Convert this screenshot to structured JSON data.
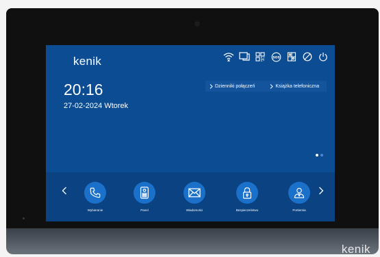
{
  "brand": "kenik",
  "clock": {
    "time": "20:16",
    "date": "27-02-2024 Wtorek"
  },
  "quick_links": [
    {
      "label": "Dzienniki połączeń"
    },
    {
      "label": "Książka telefoniczna"
    }
  ],
  "status_icons": [
    "wifi-off-icon",
    "monitor-icon",
    "qr-code-icon",
    "sos-icon",
    "door-icon",
    "do-not-disturb-icon",
    "power-icon"
  ],
  "dock": {
    "apps": [
      {
        "label": "Wybieranie",
        "icon": "phone-icon"
      },
      {
        "label": "Panel",
        "icon": "door-station-icon"
      },
      {
        "label": "Wiadomości",
        "icon": "envelope-icon"
      },
      {
        "label": "Bezpieczeństwo",
        "icon": "lock-icon"
      },
      {
        "label": "Portiernia",
        "icon": "concierge-icon"
      }
    ]
  },
  "pager": {
    "pages": 2,
    "current": 1
  },
  "colors": {
    "screen": "#0c4c93",
    "dock": "#0a4282",
    "icon_circle": "#1b70c9"
  }
}
